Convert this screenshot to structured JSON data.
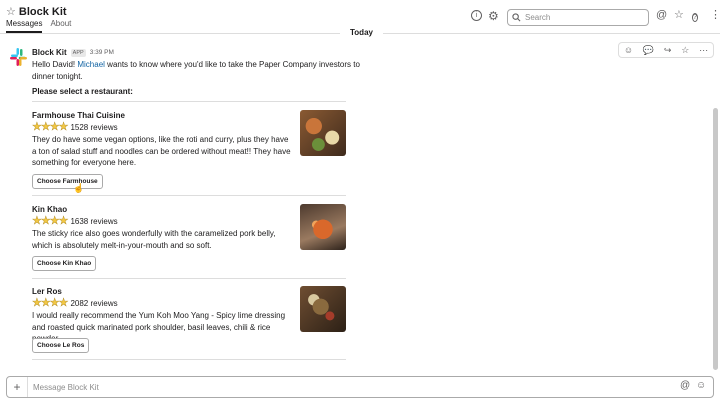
{
  "header": {
    "title": "Block Kit",
    "star_icon": "star-outline-icon",
    "tabs": [
      {
        "label": "Messages",
        "active": true
      },
      {
        "label": "About",
        "active": false
      }
    ],
    "info_glyph": "i",
    "search_placeholder": "Search"
  },
  "day_divider": "Today",
  "message": {
    "sender": "Block Kit",
    "badge": "APP",
    "time": "3:39 PM",
    "text_before": "Hello David! ",
    "mention": "Michael",
    "text_after": " wants to know where you'd like to take the Paper Company investors to dinner tonight.",
    "prompt": "Please select a restaurant:",
    "restaurants": [
      {
        "name": "Farmhouse Thai Cuisine",
        "stars": "★★★★",
        "rating": 4,
        "reviews": "1528 reviews",
        "description": "They do have some vegan options, like the roti and curry, plus they have a ton of salad stuff and noodles can be ordered without meat!! They have something for everyone here.",
        "button": "Choose Farmhouse"
      },
      {
        "name": "Kin Khao",
        "stars": "★★★★",
        "rating": 4,
        "reviews": "1638 reviews",
        "description": "The sticky rice also goes wonderfully with the caramelized pork belly, which is absolutely melt-in-your-mouth and so soft.",
        "button": "Choose Kin Khao"
      },
      {
        "name": "Ler Ros",
        "stars": "★★★★",
        "rating": 4,
        "reviews": "2082 reviews",
        "description": "I would really recommend the Yum Koh Moo Yang - Spicy lime dressing and roasted quick marinated pork shoulder, basil leaves, chili & rice powder.",
        "button": "Choose Le Ros"
      }
    ]
  },
  "composer": {
    "placeholder": "Message Block Kit",
    "plus_glyph": "+"
  },
  "colors": {
    "mention": "#1264a3",
    "star": "#f2c744",
    "border": "#dddddd",
    "text": "#1d1c1d"
  }
}
